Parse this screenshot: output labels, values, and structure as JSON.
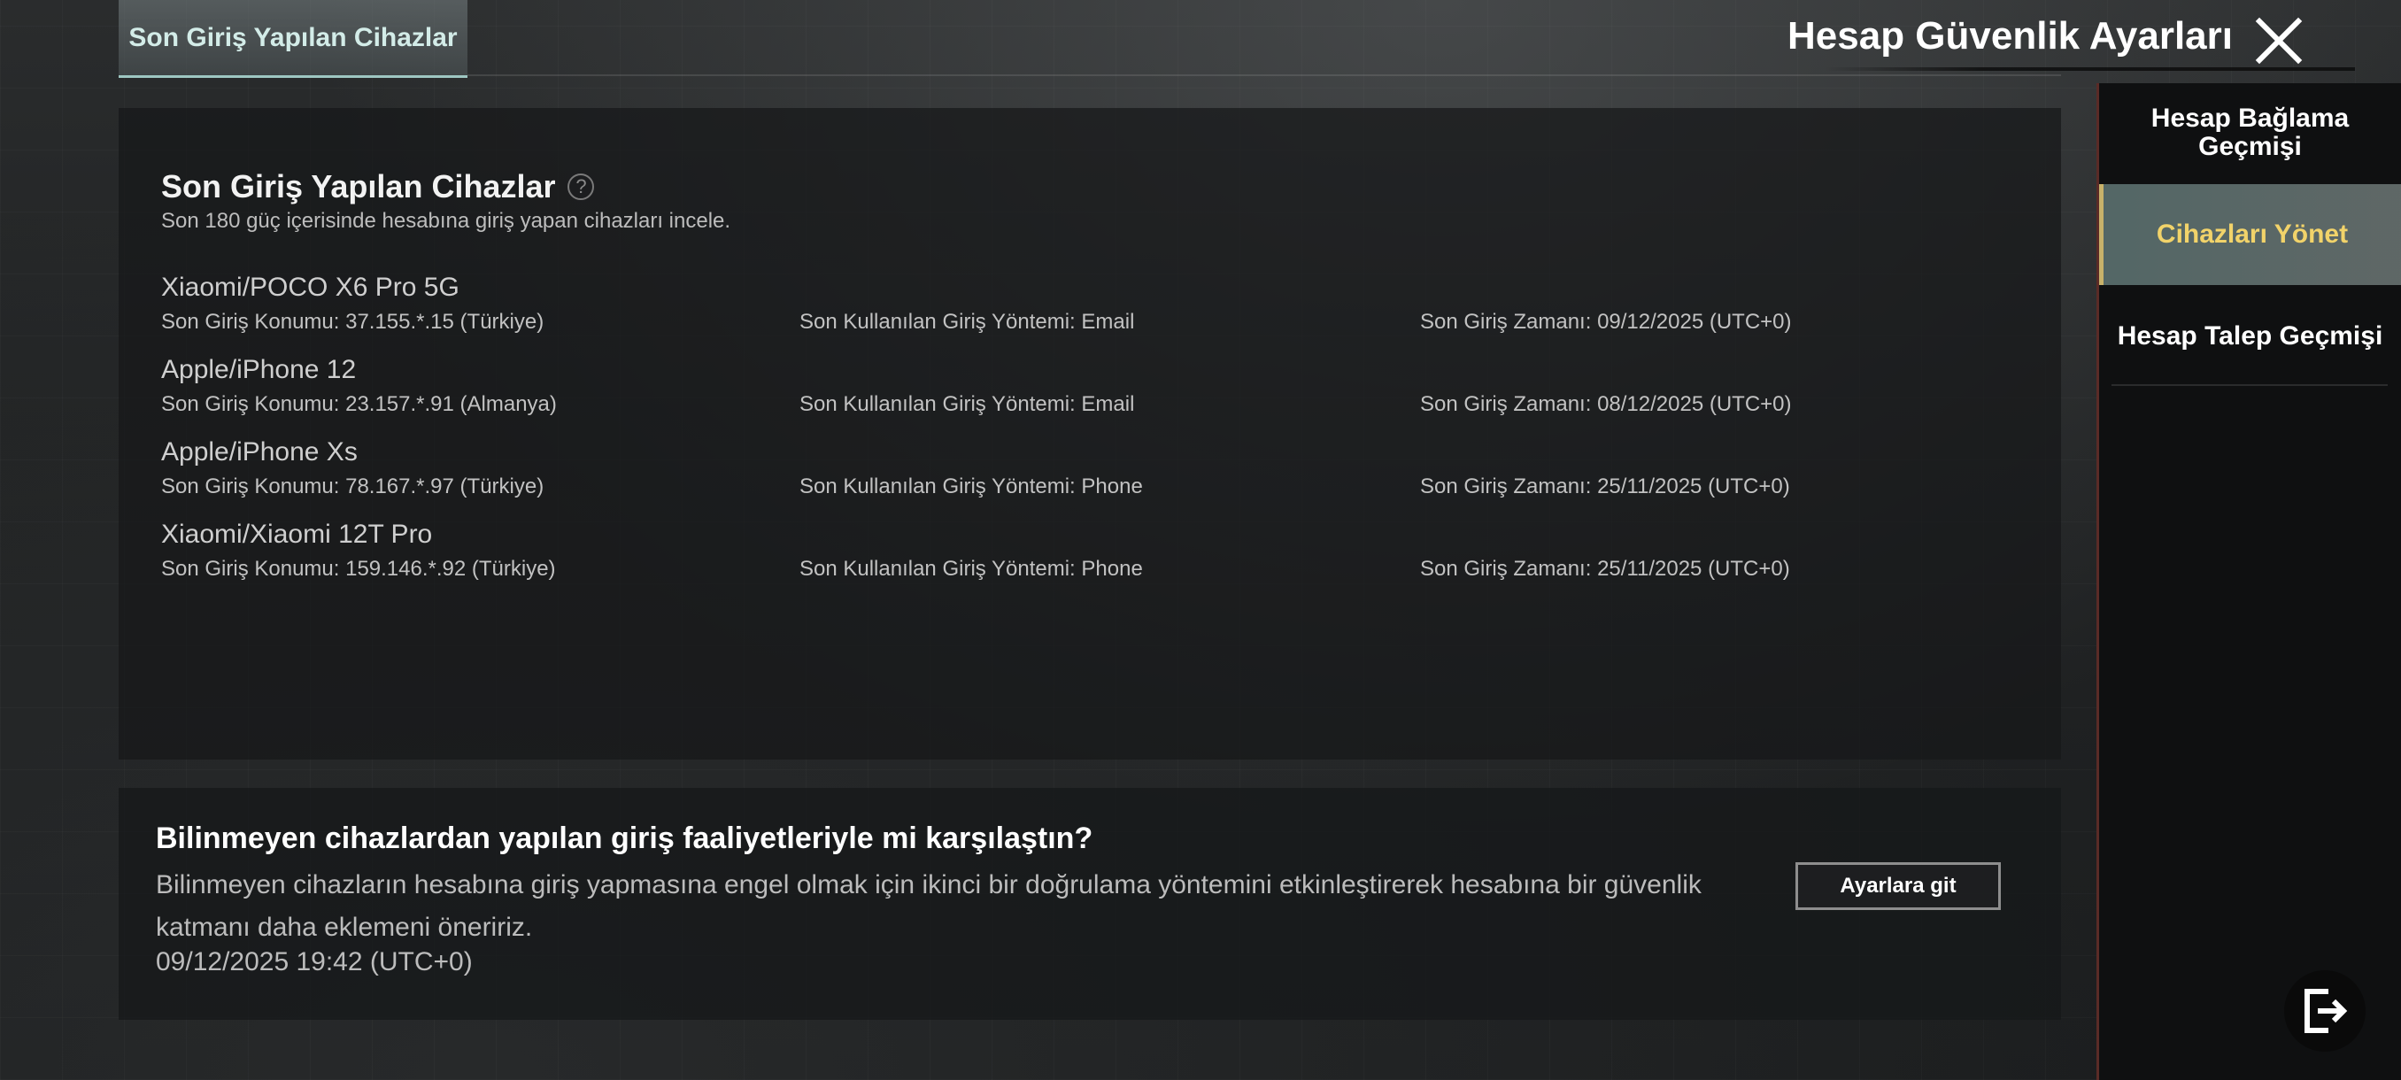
{
  "top_tab": {
    "label": "Son Giriş Yapılan Cihazlar"
  },
  "header": {
    "title": "Hesap Güvenlik Ayarları",
    "close_icon": "close-icon"
  },
  "devices_section": {
    "title": "Son Giriş Yapılan Cihazlar",
    "help_glyph": "?",
    "subtitle": "Son 180 güç içerisinde hesabına giriş yapan cihazları incele.",
    "devices": [
      {
        "name": "Xiaomi/POCO X6 Pro 5G",
        "location": "Son Giriş Konumu: 37.155.*.15 (Türkiye)",
        "method": "Son Kullanılan Giriş Yöntemi: Email",
        "time": "Son Giriş Zamanı: 09/12/2025 (UTC+0)"
      },
      {
        "name": "Apple/iPhone 12",
        "location": "Son Giriş Konumu: 23.157.*.91 (Almanya)",
        "method": "Son Kullanılan Giriş Yöntemi: Email",
        "time": "Son Giriş Zamanı: 08/12/2025 (UTC+0)"
      },
      {
        "name": "Apple/iPhone Xs",
        "location": "Son Giriş Konumu: 78.167.*.97 (Türkiye)",
        "method": "Son Kullanılan Giriş Yöntemi: Phone",
        "time": "Son Giriş Zamanı: 25/11/2025 (UTC+0)"
      },
      {
        "name": "Xiaomi/Xiaomi 12T Pro",
        "location": "Son Giriş Konumu: 159.146.*.92 (Türkiye)",
        "method": "Son Kullanılan Giriş Yöntemi: Phone",
        "time": "Son Giriş Zamanı: 25/11/2025 (UTC+0)"
      }
    ]
  },
  "notice": {
    "title": "Bilinmeyen cihazlardan yapılan giriş faaliyetleriyle mi karşılaştın?",
    "body": "Bilinmeyen cihazların hesabına giriş yapmasına engel olmak için ikinci bir doğrulama yöntemini etkinleştirerek hesabına bir güvenlik katmanı daha eklemeni öneririz.",
    "timestamp": "09/12/2025 19:42 (UTC+0)",
    "button_label": "Ayarlara git"
  },
  "sidebar": {
    "items": [
      {
        "label": "Hesap Bağlama Geçmişi",
        "selected": false
      },
      {
        "label": "Cihazları Yönet",
        "selected": true
      },
      {
        "label": "Hesap Talep Geçmişi",
        "selected": false
      }
    ],
    "selected_color": "#f2d36a"
  },
  "logout": {
    "icon": "logout-icon"
  }
}
